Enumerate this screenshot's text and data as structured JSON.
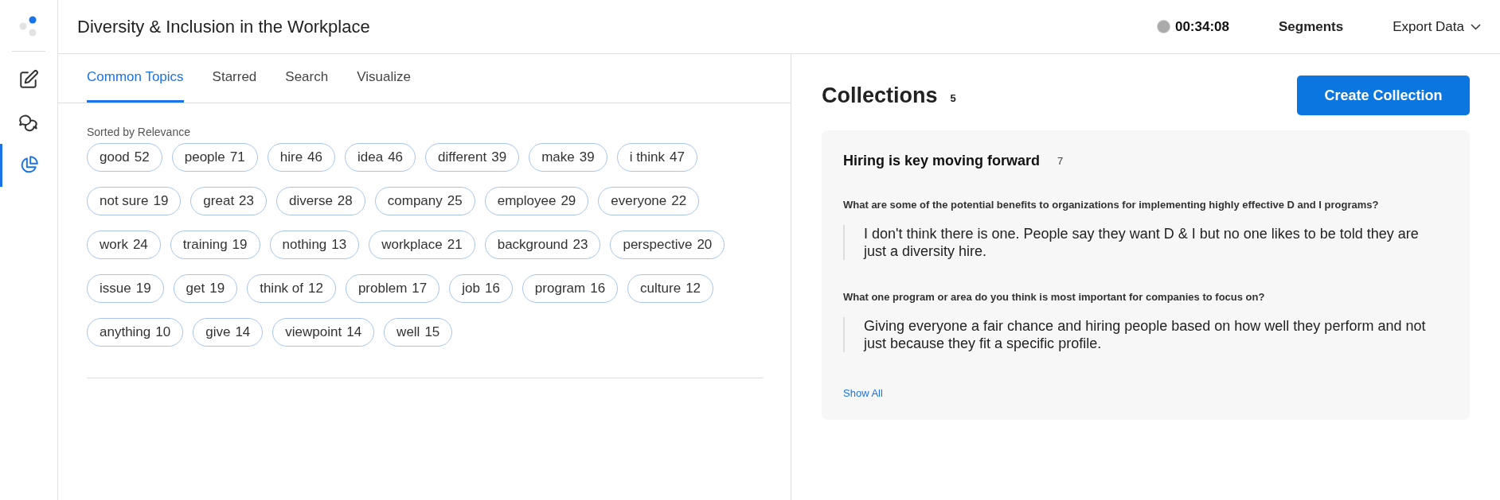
{
  "sidebar": {
    "items": [
      {
        "kind": "edit",
        "selected": false
      },
      {
        "kind": "chat",
        "selected": false
      },
      {
        "kind": "chart",
        "selected": true
      }
    ]
  },
  "header": {
    "title": "Diversity & Inclusion in the Workplace",
    "timer": "00:34:08",
    "segments": "Segments",
    "export": "Export Data"
  },
  "tabs": [
    {
      "label": "Common Topics",
      "selected": true
    },
    {
      "label": "Starred",
      "selected": false
    },
    {
      "label": "Search",
      "selected": false
    },
    {
      "label": "Visualize",
      "selected": false
    }
  ],
  "topics": {
    "sort_label": "Sorted by Relevance",
    "rows": [
      [
        {
          "word": "good",
          "count": "52"
        },
        {
          "word": "people",
          "count": "71"
        },
        {
          "word": "hire",
          "count": "46"
        },
        {
          "word": "idea",
          "count": "46"
        },
        {
          "word": "different",
          "count": "39"
        },
        {
          "word": "make",
          "count": "39"
        },
        {
          "word": "i think",
          "count": "47"
        }
      ],
      [
        {
          "word": "not sure",
          "count": "19"
        },
        {
          "word": "great",
          "count": "23"
        },
        {
          "word": "diverse",
          "count": "28"
        },
        {
          "word": "company",
          "count": "25"
        },
        {
          "word": "employee",
          "count": "29"
        },
        {
          "word": "everyone",
          "count": "22"
        }
      ],
      [
        {
          "word": "work",
          "count": "24"
        },
        {
          "word": "training",
          "count": "19"
        },
        {
          "word": "nothing",
          "count": "13"
        },
        {
          "word": "workplace",
          "count": "21"
        },
        {
          "word": "background",
          "count": "23"
        },
        {
          "word": "perspective",
          "count": "20"
        }
      ],
      [
        {
          "word": "issue",
          "count": "19"
        },
        {
          "word": "get",
          "count": "19"
        },
        {
          "word": "think of",
          "count": "12"
        },
        {
          "word": "problem",
          "count": "17"
        },
        {
          "word": "job",
          "count": "16"
        },
        {
          "word": "program",
          "count": "16"
        },
        {
          "word": "culture",
          "count": "12"
        }
      ],
      [
        {
          "word": "anything",
          "count": "10"
        },
        {
          "word": "give",
          "count": "14"
        },
        {
          "word": "viewpoint",
          "count": "14"
        },
        {
          "word": "well",
          "count": "15"
        }
      ]
    ]
  },
  "collections": {
    "title": "Collections",
    "count": "5",
    "create_button": "Create Collection",
    "items": [
      {
        "title": "Hiring is key moving forward",
        "count": "7",
        "entries": [
          {
            "question": "What are some of the potential benefits to organizations for implementing highly effective D and I programs?",
            "answer": "I don't think there is one. People say they want D & I but no one likes to be told they are just a diversity hire."
          },
          {
            "question": "What one program or area do you think is most important for companies to focus on?",
            "answer": "Giving everyone a fair chance and hiring people based on how well they perform and not just because they fit a specific profile."
          }
        ],
        "show_all": "Show All"
      }
    ]
  }
}
